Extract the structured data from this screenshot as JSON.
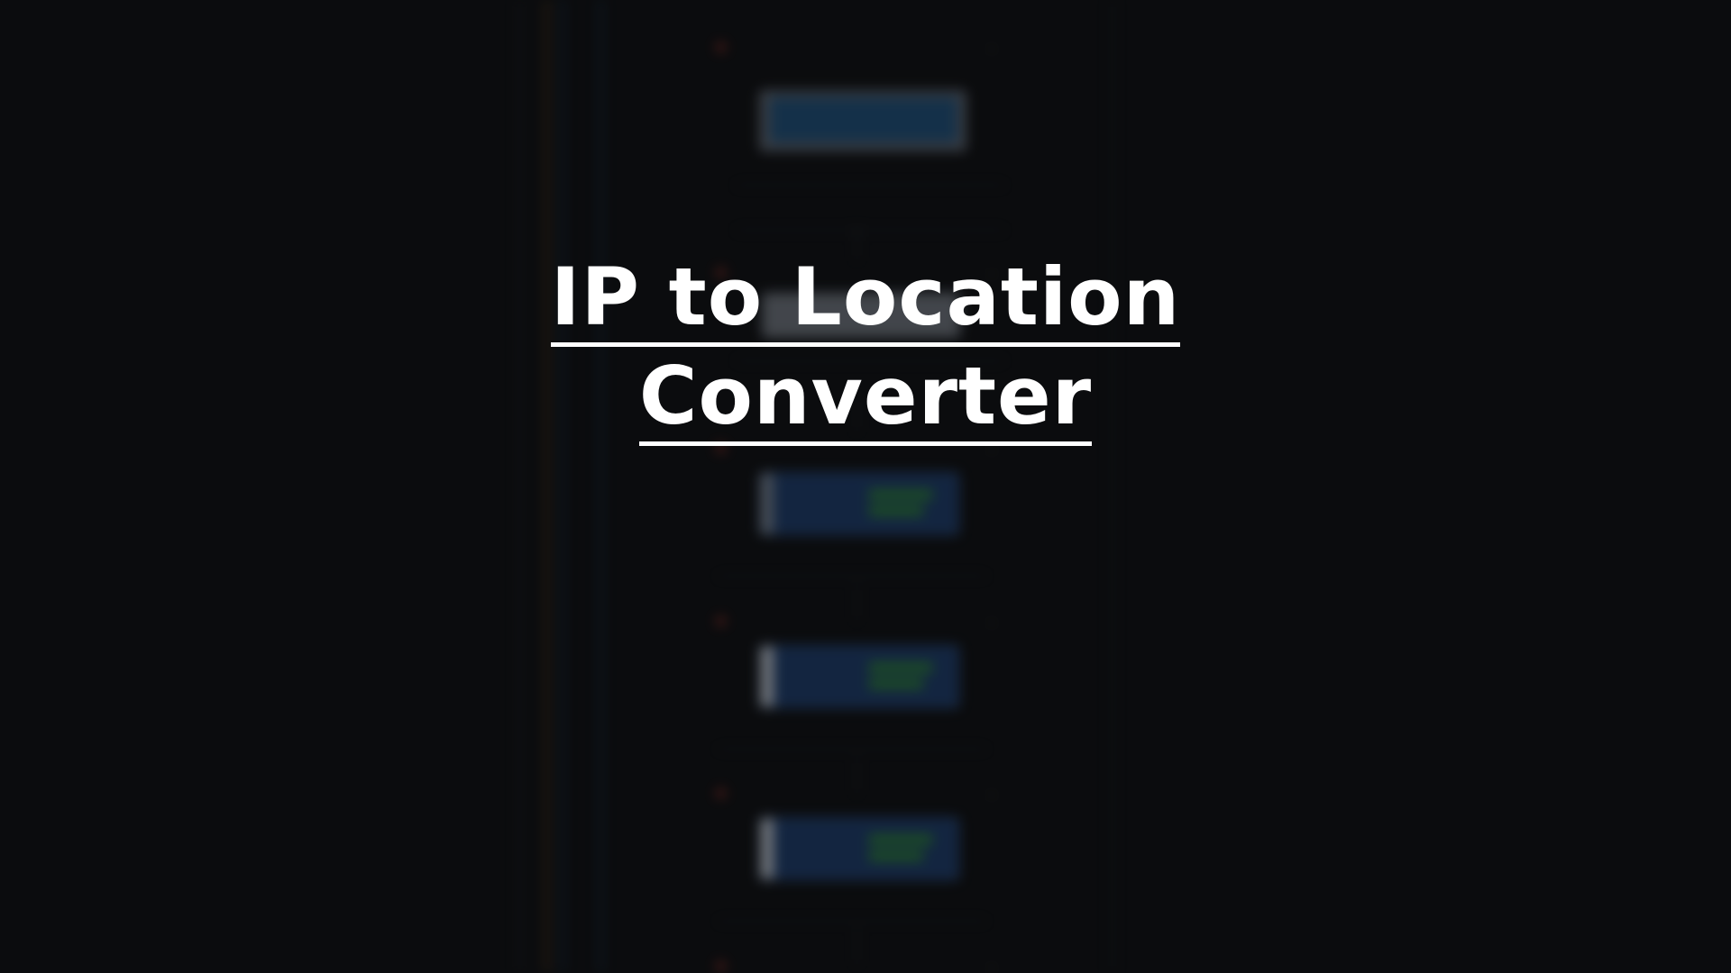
{
  "title": {
    "line1": "IP to Location",
    "line2": "Converter"
  },
  "colors": {
    "background": "#0b0c0e",
    "title_text": "#ffffff",
    "accent_orange": "#7a4a1a",
    "accent_blue": "#1a3a6a",
    "accent_green": "#2f8f2f",
    "step_dot_red": "#c0392b"
  },
  "icons": {
    "step_status": "status-dot-icon",
    "expand": "chevron-down-icon"
  }
}
